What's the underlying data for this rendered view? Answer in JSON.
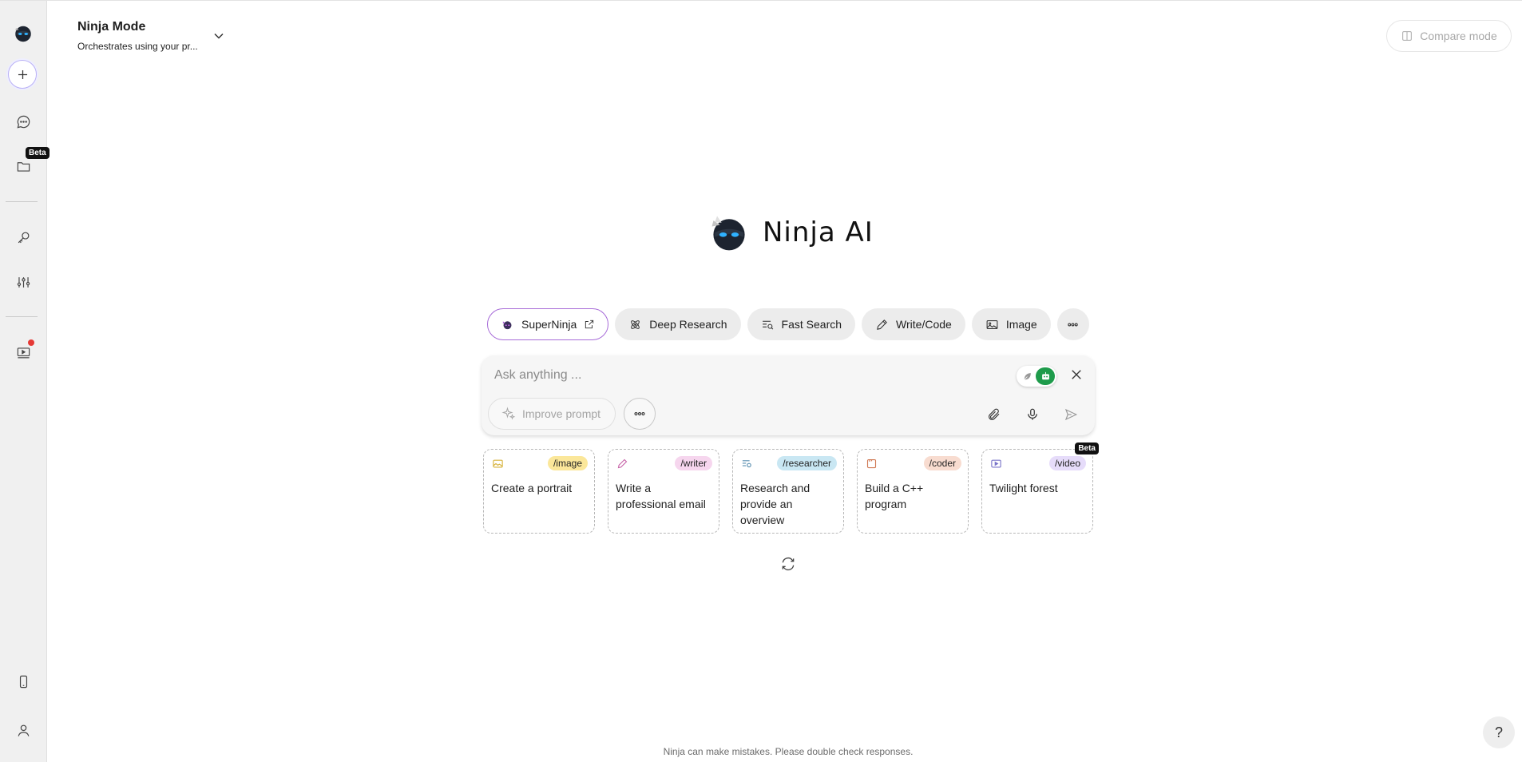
{
  "sidebar": {
    "beta_label": "Beta",
    "icons": [
      "ninja-logo-icon",
      "plus-icon",
      "chat-icon",
      "folder-icon",
      "key-icon",
      "sliders-icon",
      "video-icon",
      "phone-icon",
      "user-icon"
    ]
  },
  "header": {
    "mode_title": "Ninja Mode",
    "mode_subtitle": "Orchestrates using your pr...",
    "compare_label": "Compare mode"
  },
  "brand": {
    "name": "Ninja AI"
  },
  "tools": [
    {
      "label": "SuperNinja",
      "icon": "superninja-icon"
    },
    {
      "label": "Deep Research",
      "icon": "atom-icon"
    },
    {
      "label": "Fast Search",
      "icon": "search-list-icon"
    },
    {
      "label": "Write/Code",
      "icon": "pencil-icon"
    },
    {
      "label": "Image",
      "icon": "image-icon"
    }
  ],
  "ask": {
    "placeholder": "Ask anything ...",
    "improve_label": "Improve prompt"
  },
  "cards": [
    {
      "tag": "/image",
      "text": "Create a portrait",
      "tag_color": "#fbe79a"
    },
    {
      "tag": "/writer",
      "text": "Write a professional email",
      "tag_color": "#f6d6ee"
    },
    {
      "tag": "/researcher",
      "text": "Research and provide an overview",
      "tag_color": "#c9e7f3"
    },
    {
      "tag": "/coder",
      "text": "Build a C++ program",
      "tag_color": "#f8dcd0"
    },
    {
      "tag": "/video",
      "text": "Twilight forest",
      "tag_color": "#e6dcfa",
      "badge": "Beta"
    }
  ],
  "footer": {
    "disclaimer": "Ninja can make mistakes. Please double check responses.",
    "help": "?"
  },
  "colors": {
    "accent_green": "#1e9b4b",
    "superninja_border": "#a76bd8",
    "notification": "#e53935"
  }
}
